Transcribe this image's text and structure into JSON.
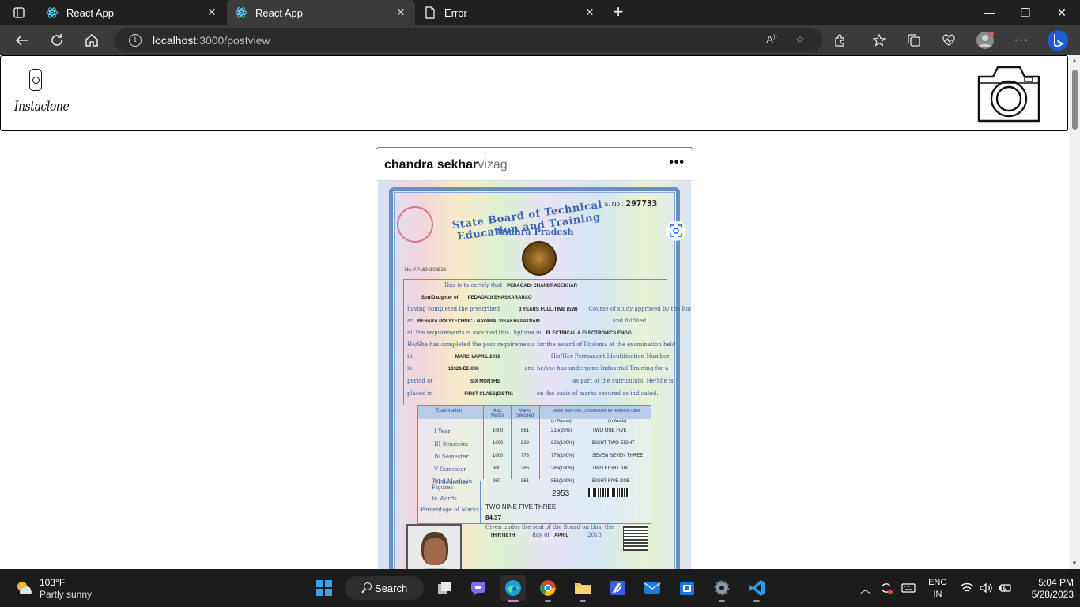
{
  "browser": {
    "tabs": [
      {
        "label": "React App",
        "icon": "react-icon"
      },
      {
        "label": "React App",
        "icon": "react-icon",
        "active": true
      },
      {
        "label": "Error",
        "icon": "page-icon"
      }
    ],
    "url_host": "localhost",
    "url_path": ":3000/postview",
    "accent": "#3b3b3b"
  },
  "app": {
    "brand": "Instaclone"
  },
  "post": {
    "author": "chandra sekhar",
    "location": "vizag",
    "more": "•••"
  },
  "certificate": {
    "title": "State Board of Technical Education and Training",
    "state": "Andhra Pradesh",
    "serial_label": "S. No :",
    "serial": "297733",
    "reg_no": "No. AP1604109526",
    "lines": {
      "l1_pre": "This is to certify that",
      "l1_val": "PEDAGADI CHANDRASEKHAR",
      "l2_pre": "Son/Daughter of",
      "l2_val": "PEDAGADI BHASKARARAO",
      "l3_pre": "having completed the prescribed",
      "l3_val": "3 YEARS FULL-TIME (SW)",
      "l3_post": "Course of study approved by the Board",
      "l4_pre": "at",
      "l4_val": "BEHARA POLYTECHNIC - NAVARA, VISAKHAPATNAM",
      "l4_post": "and fulfilled",
      "l5_pre": "all the requirements is awarded this Diploma in",
      "l5_val": "ELECTRICAL & ELECTRONICS ENGG",
      "l6": "He/She has completed the pass requirements for the award of Diploma at the examination held",
      "l7_pre": "in",
      "l7_val": "MARCH/APRIL 2016",
      "l7_post": "His/Her Permanent Identification Number",
      "l8_pre": "is",
      "l8_val": "13328-EE-008",
      "l8_post": "and he/she has undergone Industrial Training for a",
      "l9_pre": "period of",
      "l9_val": "SIX MONTHS",
      "l9_post": "as part of the curriculum. He/She is",
      "l10_pre": "placed in",
      "l10_val": "FIRST CLASS(DISTN)",
      "l10_post": "on the basis of marks secured as indicated."
    },
    "marks_headers": [
      "Examination",
      "Max. Marks",
      "Marks Secured",
      "Marks taken into Consideration for Award of Class",
      "(In Figures)",
      "(In Words)"
    ],
    "marks_rows": [
      {
        "exam": "I Year",
        "max": "1000",
        "secured": "861",
        "fig": "215(25%)",
        "words": "TWO ONE FIVE"
      },
      {
        "exam": "III Semester",
        "max": "1000",
        "secured": "828",
        "fig": "828(100%)",
        "words": "EIGHT TWO EIGHT"
      },
      {
        "exam": "IV Semester",
        "max": "1000",
        "secured": "773",
        "fig": "773(100%)",
        "words": "SEVEN SEVEN THREE"
      },
      {
        "exam": "V Semester",
        "max": "300",
        "secured": "286",
        "fig": "286(100%)",
        "words": "TWO EIGHT SIX"
      },
      {
        "exam": "VI Semester",
        "max": "950",
        "secured": "851",
        "fig": "851(100%)",
        "words": "EIGHT FIVE ONE"
      }
    ],
    "total_label": "Total Marks in Figures",
    "total": "2953",
    "words_label": "In Words",
    "total_words": "TWO NINE FIVE THREE",
    "percent_label": "Percentage of Marks :",
    "percent": "84.37",
    "given": "Given under the seal of the Board on this, the",
    "day_val": "THIRTIETH",
    "day_mid": "day of",
    "month_val": "APRIL",
    "year": "2018"
  },
  "taskbar": {
    "temp": "103°F",
    "condition": "Partly sunny",
    "search": "Search",
    "lang1": "ENG",
    "lang2": "IN",
    "time": "5:04 PM",
    "date": "5/28/2023"
  }
}
